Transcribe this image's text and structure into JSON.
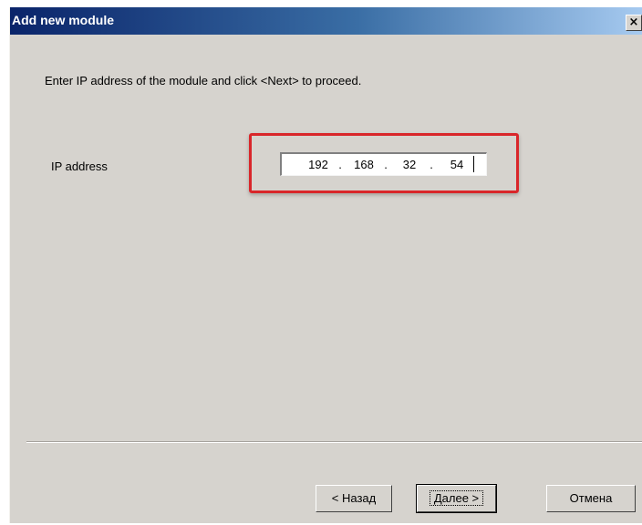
{
  "window": {
    "title": "Add new module",
    "close_glyph": "×",
    "close_icon": "close-icon"
  },
  "content": {
    "instruction": "Enter IP address of the module and click <Next> to proceed.",
    "ip_label": "IP address",
    "ip_octets": [
      "192",
      "168",
      "32",
      "54"
    ],
    "ip_separator": "."
  },
  "highlight": {
    "color": "#d9262a"
  },
  "buttons": {
    "back_label": "< Назад",
    "next_label": "Далее >",
    "cancel_label": "Отмена"
  },
  "colors": {
    "dialog_bg": "#d6d3ce",
    "title_start": "#0a246a",
    "title_end": "#a6caf0"
  }
}
